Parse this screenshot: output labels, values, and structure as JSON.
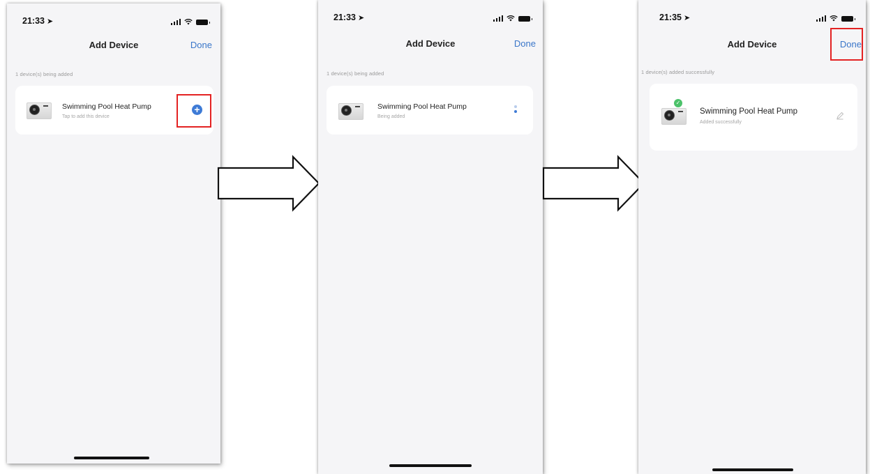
{
  "screens": [
    {
      "status": {
        "time": "21:33"
      },
      "nav": {
        "title": "Add Device",
        "done": "Done"
      },
      "section_caption": "1 device(s) being added",
      "device": {
        "name": "Swimming Pool Heat Pump",
        "subtitle": "Tap to add this device",
        "action_icon": "plus-circle-icon"
      },
      "highlight": "add-button"
    },
    {
      "status": {
        "time": "21:33"
      },
      "nav": {
        "title": "Add Device",
        "done": "Done"
      },
      "section_caption": "1 device(s) being added",
      "device": {
        "name": "Swimming Pool Heat Pump",
        "subtitle": "Being added",
        "action_icon": "loading-icon"
      }
    },
    {
      "status": {
        "time": "21:35"
      },
      "nav": {
        "title": "Add Device",
        "done": "Done"
      },
      "section_caption": "1 device(s) added successfully",
      "device": {
        "name": "Swimming Pool Heat Pump",
        "subtitle": "Added successfully",
        "action_icon": "edit-icon",
        "badge_icon": "check-badge-icon"
      },
      "highlight": "done-button"
    }
  ],
  "arrows": [
    "right-arrow-icon",
    "right-arrow-icon"
  ],
  "colors": {
    "accent": "#3e7bd6",
    "done_link": "#3a76c9",
    "highlight": "#e32222",
    "success": "#4cc26a"
  }
}
